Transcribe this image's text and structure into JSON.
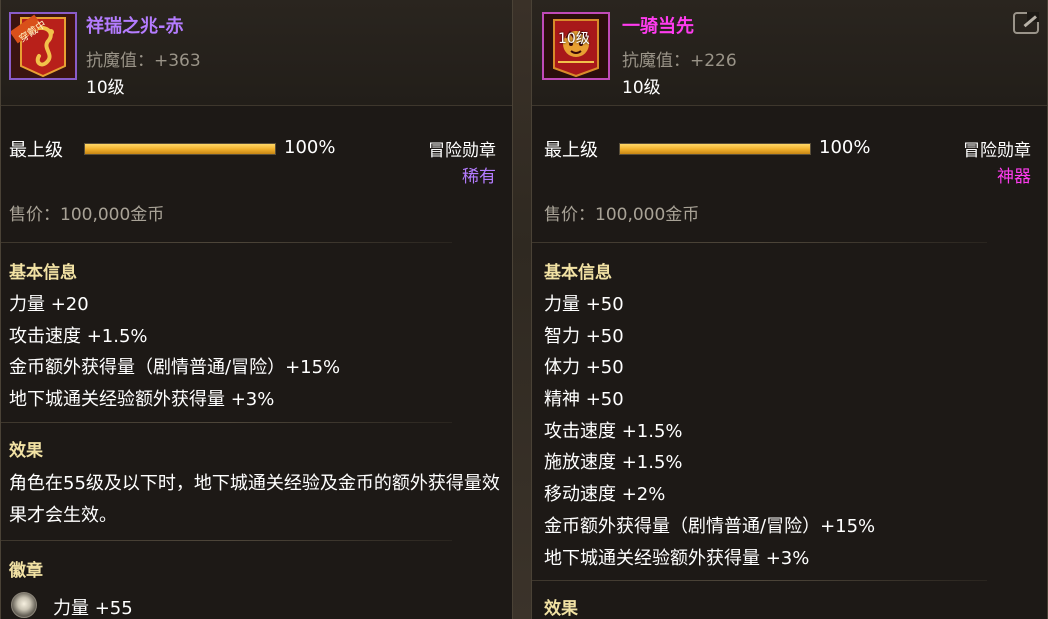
{
  "colors": {
    "epic_purple": "#b47cff",
    "mythic_magenta": "#ff3cf0",
    "gold_bar": "#f3b22e",
    "section_yellow": "#f2e2a4"
  },
  "left": {
    "icon": "red-dragon-banner-icon",
    "icon_label": "穿戴中",
    "name": "祥瑞之兆-赤",
    "resist": "抗魔值：+363",
    "level": "10级",
    "grade": {
      "label": "最上级",
      "percent": "100%",
      "value": 100
    },
    "type": "冒险勋章",
    "rarity": "稀有",
    "price": "售价：100,000金币",
    "basic_title": "基本信息",
    "basic_stats": [
      "力量 +20",
      "攻击速度 +1.5%",
      "金币额外获得量（剧情普通/冒险）+15%",
      "地下城通关经验额外获得量 +3%"
    ],
    "effect_title": "效果",
    "effect_text": "角色在55级及以下时，地下城通关经验及金币的额外获得量效果才会生效。",
    "emblem_title": "徽章",
    "emblem_stat": "力量 +55"
  },
  "right": {
    "icon": "red-tiger-banner-icon",
    "badge": "10级",
    "name": "一骑当先",
    "resist": "抗魔值：+226",
    "level": "10级",
    "grade": {
      "label": "最上级",
      "percent": "100%",
      "value": 100
    },
    "type": "冒险勋章",
    "rarity": "神器",
    "price": "售价：100,000金币",
    "basic_title": "基本信息",
    "basic_stats": [
      "力量 +50",
      "智力 +50",
      "体力 +50",
      "精神 +50",
      "攻击速度 +1.5%",
      "施放速度 +1.5%",
      "移动速度 +2%",
      "金币额外获得量（剧情普通/冒险）+15%",
      "地下城通关经验额外获得量 +3%"
    ],
    "effect_title": "效果",
    "external_icon": "external-link-icon"
  }
}
